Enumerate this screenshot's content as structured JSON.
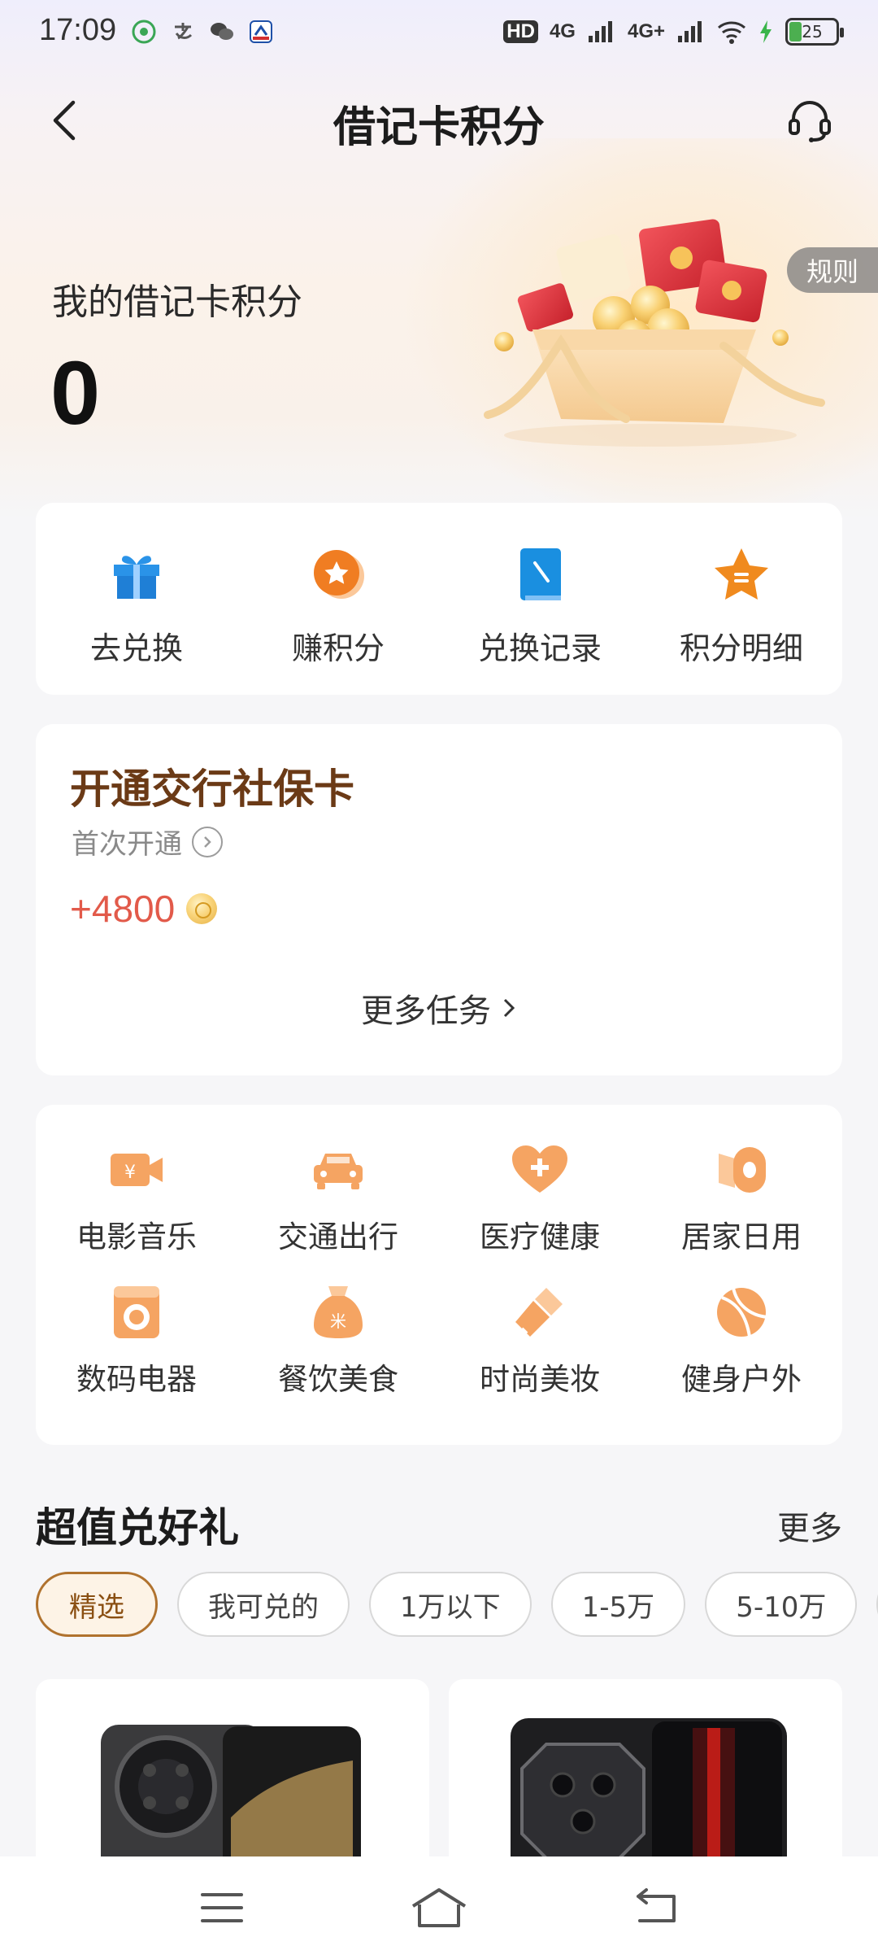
{
  "status_bar": {
    "time": "17:09",
    "hd_label": "HD",
    "net1": "4G",
    "net2": "4G+",
    "battery": "25",
    "icons": [
      "android-app-icon",
      "alipay-icon",
      "wechat-icon",
      "bank-app-icon",
      "hd-icon",
      "signal-icon",
      "wifi-icon",
      "charging-icon",
      "battery-icon"
    ]
  },
  "nav": {
    "title": "借记卡积分",
    "back_icon": "chevron-left-icon",
    "service_icon": "headset-icon"
  },
  "points": {
    "label": "我的借记卡积分",
    "value": "0",
    "rules": "规则"
  },
  "quick_actions": [
    {
      "label": "去兑换",
      "icon": "gift-icon",
      "color": "#1a8fe0"
    },
    {
      "label": "赚积分",
      "icon": "star-coin-icon",
      "color": "#f07d22"
    },
    {
      "label": "兑换记录",
      "icon": "record-icon",
      "color": "#1a8fe0"
    },
    {
      "label": "积分明细",
      "icon": "star-detail-icon",
      "color": "#f07d22"
    }
  ],
  "task": {
    "title": "开通交行社保卡",
    "subtitle": "首次开通",
    "points": "+4800",
    "more": "更多任务",
    "colors": {
      "title": "#6b3a16",
      "points": "#e25a4a"
    }
  },
  "categories": [
    {
      "label": "电影音乐",
      "icon": "movie-camera-icon"
    },
    {
      "label": "交通出行",
      "icon": "car-icon"
    },
    {
      "label": "医疗健康",
      "icon": "heart-plus-icon"
    },
    {
      "label": "居家日用",
      "icon": "tissue-roll-icon"
    },
    {
      "label": "数码电器",
      "icon": "washing-machine-icon"
    },
    {
      "label": "餐饮美食",
      "icon": "rice-bag-icon"
    },
    {
      "label": "时尚美妆",
      "icon": "lipstick-icon"
    },
    {
      "label": "健身户外",
      "icon": "ball-icon"
    }
  ],
  "gifts": {
    "title": "超值兑好礼",
    "more": "更多",
    "filters": [
      "精选",
      "我可兑的",
      "1万以下",
      "1-5万",
      "5-10万"
    ],
    "active_filter": "精选",
    "products": [
      {
        "name": "phone-product-1",
        "color": "#3a3a3c"
      },
      {
        "name": "phone-product-2",
        "color": "#1e1e20"
      }
    ]
  },
  "system_nav": {
    "icons": [
      "menu-icon",
      "home-icon",
      "back-icon"
    ]
  },
  "theme": {
    "accent_orange": "#f5a462",
    "accent_blue": "#1a8fe0",
    "chip_active": "#b0722e"
  }
}
